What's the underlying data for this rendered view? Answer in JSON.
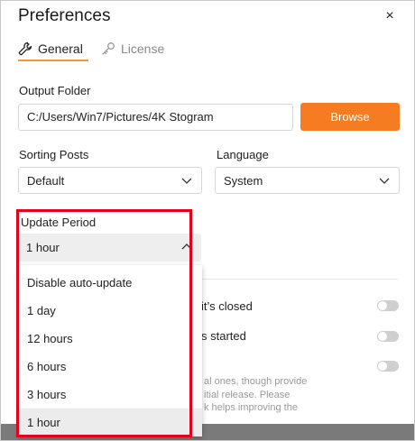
{
  "window": {
    "title": "Preferences",
    "close_glyph": "×"
  },
  "tabs": [
    {
      "label": "General",
      "icon": "wrench-icon",
      "active": true
    },
    {
      "label": "License",
      "icon": "key-icon",
      "active": false
    }
  ],
  "output_folder": {
    "label": "Output Folder",
    "value": "C:/Users/Win7/Pictures/4K Stogram",
    "browse_label": "Browse"
  },
  "sorting_posts": {
    "label": "Sorting Posts",
    "value": "Default"
  },
  "language": {
    "label": "Language",
    "value": "System"
  },
  "update_period": {
    "label": "Update Period",
    "value": "1 hour",
    "options": [
      "Disable auto-update",
      "1 day",
      "12 hours",
      "6 hours",
      "3 hours",
      "1 hour"
    ],
    "selected_index": 5
  },
  "toggles": [
    {
      "text": "it’s closed",
      "on": false
    },
    {
      "text": "s started",
      "on": false
    },
    {
      "text": "",
      "on": false
    }
  ],
  "description_lines": [
    "al ones, though provide",
    "itial release. Please",
    "k helps improving the"
  ],
  "colors": {
    "accent": "#f57c20",
    "tab_underline": "#f39635",
    "highlight_border": "#e3001b",
    "toggle_off": "#cfcfcf"
  }
}
